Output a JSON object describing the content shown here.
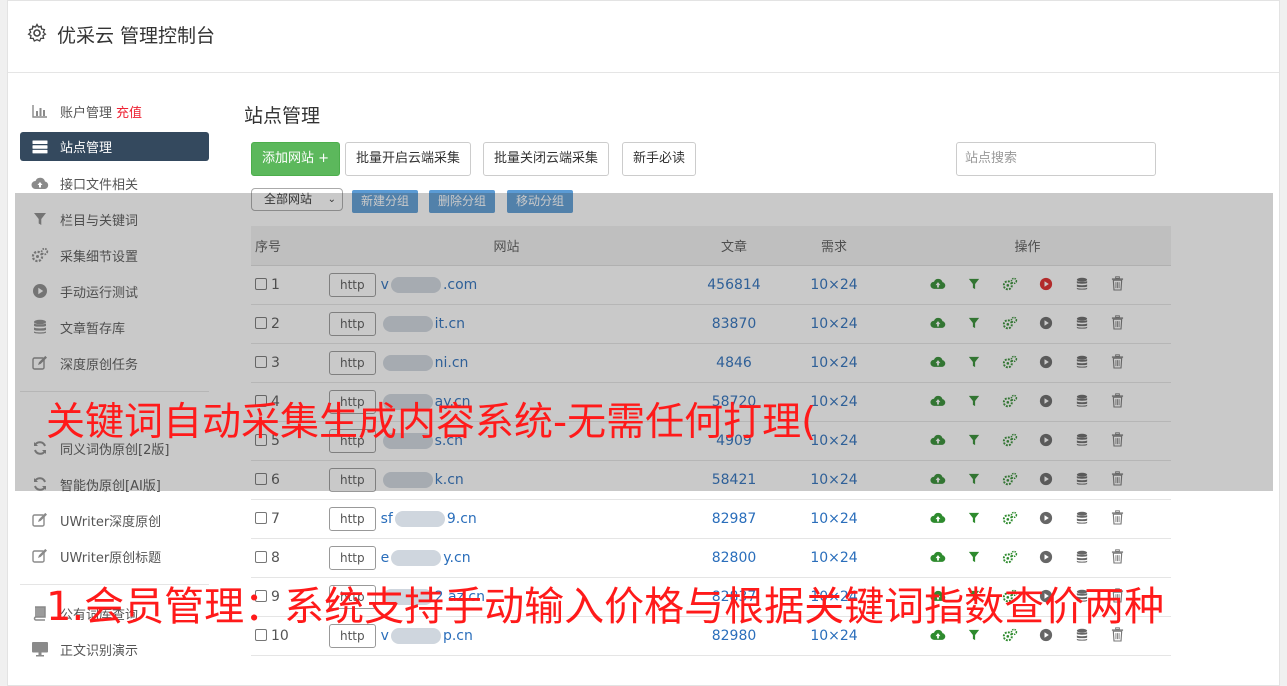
{
  "header": {
    "title": "优采云 管理控制台"
  },
  "sidebar": {
    "items": [
      {
        "label": "账户管理",
        "extra": "充值",
        "icon": "bar-chart-icon"
      },
      {
        "label": "站点管理",
        "icon": "server-icon",
        "active": true
      },
      {
        "label": "接口文件相关",
        "icon": "cloud-upload-icon"
      },
      {
        "label": "栏目与关键词",
        "icon": "filter-icon"
      },
      {
        "label": "采集细节设置",
        "icon": "gears-icon"
      },
      {
        "label": "手动运行测试",
        "icon": "play-circle-icon"
      },
      {
        "label": "文章暂存库",
        "icon": "database-icon"
      },
      {
        "label": "深度原创任务",
        "icon": "edit-icon"
      }
    ],
    "items2": [
      {
        "label": "同义词伪原创[2版]",
        "icon": "refresh-icon"
      },
      {
        "label": "智能伪原创[AI版]",
        "icon": "refresh-icon"
      },
      {
        "label": "UWriter深度原创",
        "icon": "edit-icon"
      },
      {
        "label": "UWriter原创标题",
        "icon": "edit-icon"
      }
    ],
    "items3": [
      {
        "label": "公有词库查询",
        "icon": "book-icon"
      },
      {
        "label": "正文识别演示",
        "icon": "monitor-icon"
      }
    ]
  },
  "main": {
    "title": "站点管理",
    "buttons": {
      "add": "添加网站 +",
      "batch_open": "批量开启云端采集",
      "batch_close": "批量关闭云端采集",
      "guide": "新手必读"
    },
    "search_placeholder": "站点搜索",
    "group_select": "全部网站",
    "group_buttons": {
      "new": "新建分组",
      "delete": "删除分组",
      "move": "移动分组"
    },
    "table": {
      "headers": {
        "num": "序号",
        "site": "网站",
        "articles": "文章",
        "demand": "需求",
        "ops": "操作"
      },
      "rows": [
        {
          "num": "1",
          "prefix": "http",
          "pre": "v",
          "post": ".com",
          "articles": "456814",
          "demand": "10×24",
          "run_active": true
        },
        {
          "num": "2",
          "prefix": "http",
          "pre": "",
          "post": "it.cn",
          "articles": "83870",
          "demand": "10×24",
          "run_active": false
        },
        {
          "num": "3",
          "prefix": "http",
          "pre": "",
          "post": "ni.cn",
          "articles": "4846",
          "demand": "10×24",
          "run_active": false
        },
        {
          "num": "4",
          "prefix": "http",
          "pre": "",
          "post": "ay.cn",
          "articles": "58720",
          "demand": "10×24",
          "run_active": false
        },
        {
          "num": "5",
          "prefix": "http",
          "pre": "",
          "post": "s.cn",
          "articles": "4909",
          "demand": "10×24",
          "run_active": false
        },
        {
          "num": "6",
          "prefix": "http",
          "pre": "",
          "post": "k.cn",
          "articles": "58421",
          "demand": "10×24",
          "run_active": false
        },
        {
          "num": "7",
          "prefix": "http",
          "pre": "sf",
          "post": "9.cn",
          "articles": "82987",
          "demand": "10×24",
          "run_active": false
        },
        {
          "num": "8",
          "prefix": "http",
          "pre": "e",
          "post": "y.cn",
          "articles": "82800",
          "demand": "10×24",
          "run_active": false
        },
        {
          "num": "9",
          "prefix": "http",
          "pre": "",
          "post": "2 az.cn",
          "articles": "82837",
          "demand": "10×24",
          "run_active": false
        },
        {
          "num": "10",
          "prefix": "http",
          "pre": "v",
          "post": "p.cn",
          "articles": "82980",
          "demand": "10×24",
          "run_active": false
        }
      ]
    }
  },
  "overlay_text": {
    "line1": "关键词自动采集生成内容系统-无需任何打理(",
    "line2": "1.会员管理：系统支持手动输入价格与根据关键词指数查价两种"
  },
  "colors": {
    "sidebar_active": "#34495e",
    "green": "#5cb85c",
    "link_blue": "#2a6ebb",
    "red": "#ff1a1a",
    "icon_green": "#2e8b2e",
    "run_red": "#e02424"
  }
}
